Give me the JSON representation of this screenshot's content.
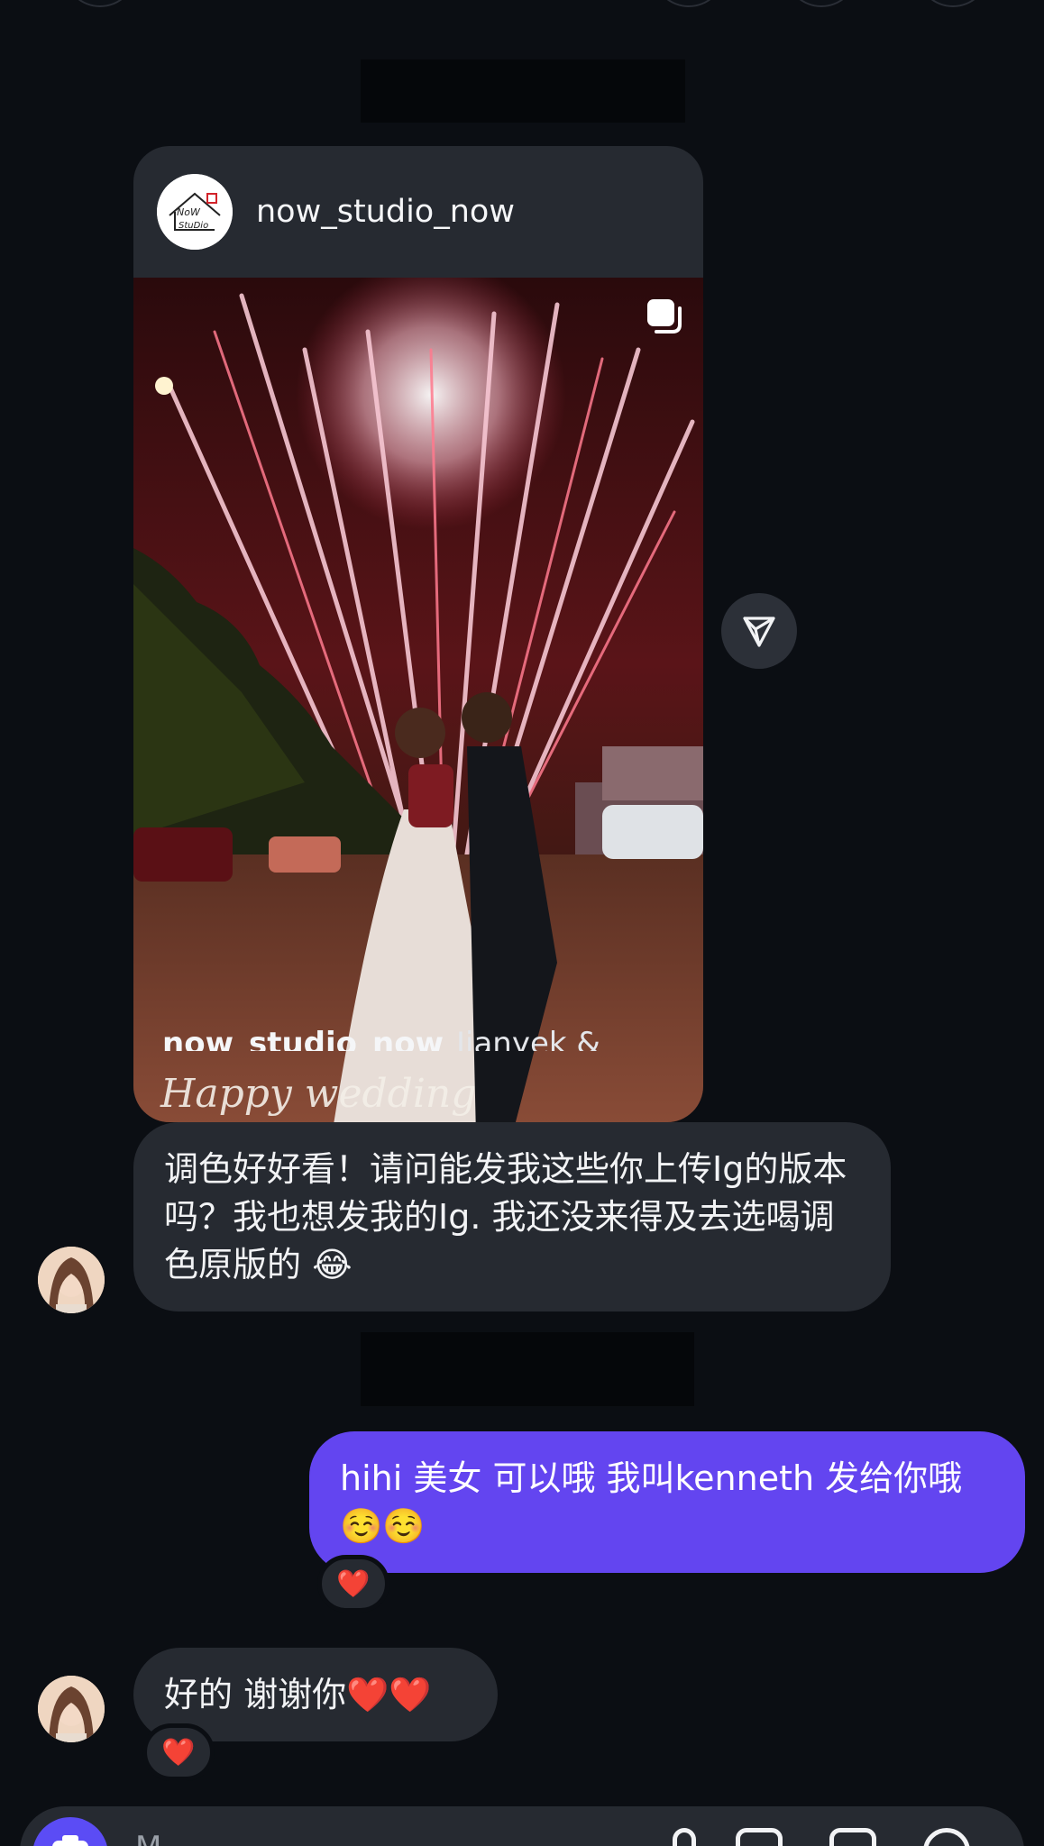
{
  "shared_post": {
    "username": "now_studio_now",
    "logo_text": "NoW STuDio",
    "caption_username": "now_studio_now",
    "caption_text": "Jianyek &",
    "image_watermark": "Happy wedding"
  },
  "messages": [
    {
      "from": "them",
      "text": "调色好好看！请问能发我这些你上传Ig的版本吗？我也想发我的Ig. 我还没来得及去选喝调色原版的 😂"
    },
    {
      "from": "me",
      "text": "hihi 美女 可以哦 我叫kenneth 发给你哦☺️☺️",
      "reaction": "❤️"
    },
    {
      "from": "them",
      "text": "好的 谢谢你❤️❤️",
      "reaction": "❤️"
    }
  ],
  "composer": {
    "placeholder": "M"
  },
  "colors": {
    "background": "#0b0e13",
    "incoming_bubble": "#262a31",
    "outgoing_bubble": "#6345f0"
  }
}
